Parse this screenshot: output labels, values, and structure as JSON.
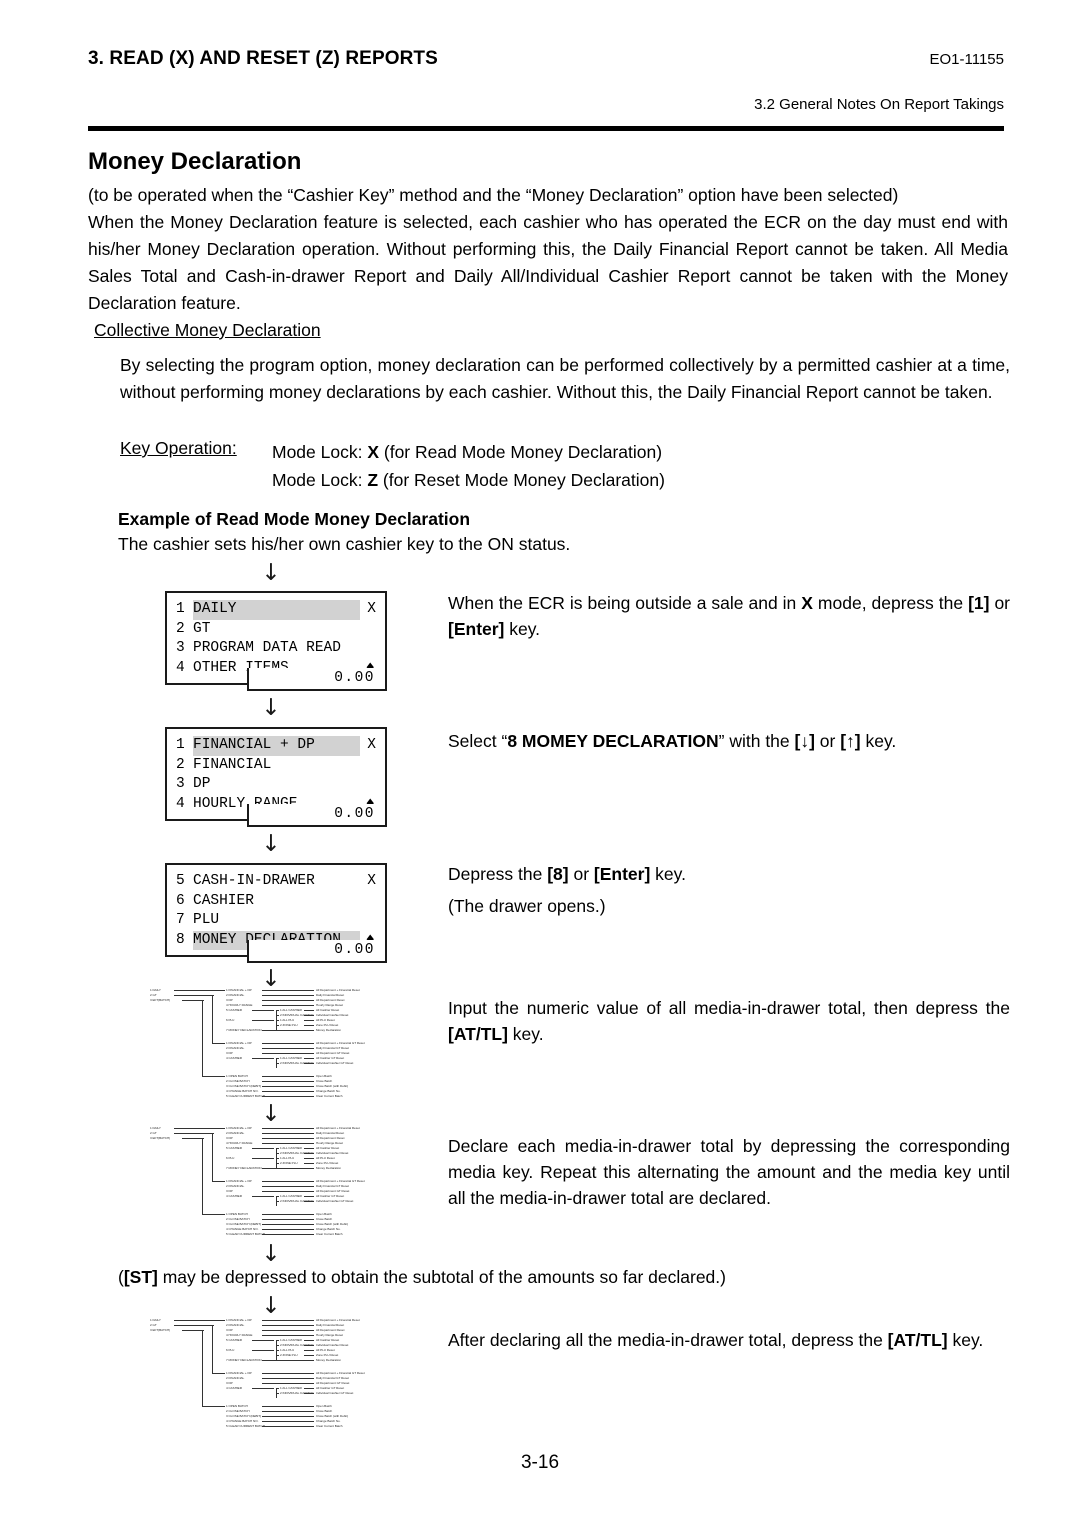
{
  "header": {
    "section_title": "3. READ (X) AND RESET (Z) REPORTS",
    "doc_code": "EO1-11155",
    "subsection": "3.2 General Notes On Report Takings"
  },
  "page_number": "3-16",
  "main": {
    "heading": "Money Declaration",
    "intro_line1": "(to be operated when the “Cashier Key” method and the “Money Declaration” option have been selected)",
    "intro_body": "When the Money Declaration feature is selected, each cashier who has operated the ECR on the day must end with his/her Money Declaration operation.  Without performing this, the Daily Financial Report cannot be taken.  All Media Sales Total and Cash-in-drawer Report and Daily All/Individual Cashier Report cannot be taken with the Money Declaration feature.",
    "collective_heading": "Collective Money Declaration",
    "collective_body": "By selecting the program option, money declaration can be performed collectively by a permitted cashier at a time, without performing money declarations by each cashier.  Without this, the Daily Financial Report cannot be taken.",
    "key_operation_label": "Key Operation:",
    "key_operation_lines": [
      {
        "prefix": "Mode Lock: ",
        "key": "X",
        "suffix": " (for Read Mode Money Declaration)"
      },
      {
        "prefix": "Mode Lock: ",
        "key": "Z",
        "suffix": " (for Reset Mode Money Declaration)"
      }
    ],
    "example_heading": "Example of Read Mode Money Declaration",
    "example_lead": "The cashier sets his/her own cashier key to the ON status.",
    "st_note_prefix": "(",
    "st_note_key": "[ST]",
    "st_note_suffix": " may be depressed to obtain the subtotal of the amounts so far declared.)"
  },
  "arrow_glyph": "↓",
  "lcd_panels": [
    {
      "name": "daily-menu",
      "mode": "X",
      "total": "0.00",
      "lines": [
        {
          "num": "1",
          "text": "DAILY",
          "selected": true,
          "right": "X",
          "right_kind": "mode"
        },
        {
          "num": "2",
          "text": "GT",
          "selected": false,
          "right": "",
          "right_kind": "none"
        },
        {
          "num": "3",
          "text": "PROGRAM DATA READ",
          "selected": false,
          "right": "",
          "right_kind": "none"
        },
        {
          "num": "4",
          "text": "OTHER ITEMS",
          "selected": false,
          "right": "♦",
          "right_kind": "scroll"
        }
      ]
    },
    {
      "name": "financial-menu",
      "mode": "X",
      "total": "0.00",
      "lines": [
        {
          "num": "1",
          "text": "FINANCIAL + DP",
          "selected": true,
          "right": "X",
          "right_kind": "mode"
        },
        {
          "num": "2",
          "text": "FINANCIAL",
          "selected": false,
          "right": "",
          "right_kind": "none"
        },
        {
          "num": "3",
          "text": "DP",
          "selected": false,
          "right": "",
          "right_kind": "none"
        },
        {
          "num": "4",
          "text": "HOURLY RANGE",
          "selected": false,
          "right": "♦",
          "right_kind": "scroll"
        }
      ]
    },
    {
      "name": "money-declaration-menu",
      "mode": "X",
      "total": "0.00",
      "lines": [
        {
          "num": "5",
          "text": "CASH-IN-DRAWER",
          "selected": false,
          "right": "X",
          "right_kind": "mode"
        },
        {
          "num": "6",
          "text": "CASHIER",
          "selected": false,
          "right": "",
          "right_kind": "none"
        },
        {
          "num": "7",
          "text": "PLU",
          "selected": false,
          "right": "",
          "right_kind": "none"
        },
        {
          "num": "8",
          "text": "MONEY DECLARATION",
          "selected": true,
          "right": "♦",
          "right_kind": "scroll"
        }
      ]
    }
  ],
  "instructions": [
    {
      "name": "step-1",
      "parts": [
        {
          "t": "When the ECR is being outside a sale and in ",
          "b": false
        },
        {
          "t": "X",
          "b": true
        },
        {
          "t": " mode, depress the ",
          "b": false
        },
        {
          "t": "[1]",
          "b": true
        },
        {
          "t": " or ",
          "b": false
        },
        {
          "t": "[Enter]",
          "b": true
        },
        {
          "t": " key.",
          "b": false
        }
      ]
    },
    {
      "name": "step-2",
      "parts": [
        {
          "t": "Select “",
          "b": false
        },
        {
          "t": "8 MOMEY DECLARATION",
          "b": true
        },
        {
          "t": "” with the ",
          "b": false
        },
        {
          "t": "[↓]",
          "b": true
        },
        {
          "t": " or ",
          "b": false
        },
        {
          "t": "[↑]",
          "b": true
        },
        {
          "t": " key.",
          "b": false
        }
      ]
    },
    {
      "name": "step-3",
      "parts": [
        {
          "t": "Depress the ",
          "b": false
        },
        {
          "t": "[8]",
          "b": true
        },
        {
          "t": " or ",
          "b": false
        },
        {
          "t": "[Enter]",
          "b": true
        },
        {
          "t": " key.",
          "b": false
        }
      ],
      "second_line": "(The drawer opens.)"
    },
    {
      "name": "step-4",
      "parts": [
        {
          "t": "Input the numeric value of all media-in-drawer total, then depress the ",
          "b": false
        },
        {
          "t": "[AT/TL]",
          "b": true
        },
        {
          "t": " key.",
          "b": false
        }
      ]
    },
    {
      "name": "step-5",
      "parts": [
        {
          "t": "Declare each media-in-drawer total by depressing the corresponding media key.  Repeat this alternating the amount and the media key until all the media-in-drawer total are declared.",
          "b": false
        }
      ]
    },
    {
      "name": "step-6",
      "parts": [
        {
          "t": "After declaring all the media-in-drawer total, depress the ",
          "b": false
        },
        {
          "t": "[AT/TL]",
          "b": true
        },
        {
          "t": " key.",
          "b": false
        }
      ]
    }
  ],
  "receipt_tree": {
    "left_column": [
      "1 DAILY",
      "2 GT",
      "3 EFT(BATCH)"
    ],
    "blocks": [
      {
        "items": [
          {
            "label": "1 FINANCIAL + DP",
            "desc": "All Department + Financial Reset"
          },
          {
            "label": "2 FINANCIAL",
            "desc": "Daily Financial Reset"
          },
          {
            "label": "3 DP",
            "desc": "All Department Reset"
          },
          {
            "label": "4 HOURLY RANGE",
            "desc": "Hourly Range Reset"
          },
          {
            "label": "5 CASHIER",
            "desc": "",
            "children": [
              {
                "label": "1 ALL CASHIER",
                "desc": "All Cashier Reset"
              },
              {
                "label": "2 INDIVIDUAL CASHIER",
                "desc": "Individual Cashier Reset"
              }
            ]
          },
          {
            "label": "6 PLU",
            "desc": "",
            "children": [
              {
                "label": "1 ALL PLU",
                "desc": "All PLU Reset"
              },
              {
                "label": "2 ZONE PLU",
                "desc": "Zone PLU Reset"
              }
            ]
          },
          {
            "label": "7 MONEY DECLARATION",
            "desc": "Money Declaration"
          }
        ]
      },
      {
        "items": [
          {
            "label": "1 FINANCIAL + DP",
            "desc": "All Department + Financial GT Reset"
          },
          {
            "label": "2 FINANCIAL",
            "desc": "Daily Financial GT Reset"
          },
          {
            "label": "3 DP",
            "desc": "All Department GT Reset"
          },
          {
            "label": "4 CASHIER",
            "desc": "",
            "children": [
              {
                "label": "1 ALL CASHIER",
                "desc": "All Cashier GT Reset"
              },
              {
                "label": "2 INDIVIDUAL CASHIER",
                "desc": "Individual Cashier GT Reset"
              }
            ]
          }
        ]
      },
      {
        "items": [
          {
            "label": "1 OPEN BATCH",
            "desc": "Open Batch"
          },
          {
            "label": "2 CLOSE BATCH",
            "desc": "Close Batch"
          },
          {
            "label": "3 CLOSE BATCH (DEBIT)",
            "desc": "Close Batch (with Debit)"
          },
          {
            "label": "4 CHANGE BATCH NO.",
            "desc": "Change Batch No."
          },
          {
            "label": "5 CLEAR CURRENT BATCH",
            "desc": "Clear Current Batch"
          }
        ]
      }
    ]
  }
}
